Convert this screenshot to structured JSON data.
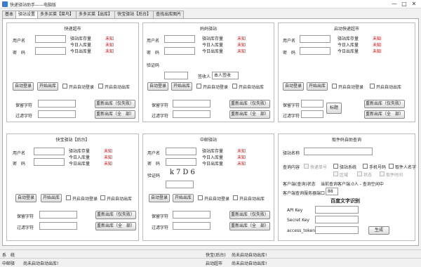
{
  "window": {
    "title": "快递驿站助手——电脑版",
    "min": "—",
    "max": "□",
    "close": "✕"
  },
  "tabs": [
    "基本",
    "驿站设置",
    "多多买菜【菜鸟】",
    "多多买菜【出库】",
    "快宝驿站【后台】",
    "查找出库图片"
  ],
  "common": {
    "user_label": "用户名",
    "pwd_label": "密　码",
    "stock_label": "驿站库存量",
    "today_in_label": "今日入库量",
    "today_out_label": "今日出库量",
    "unknown": "未知",
    "auto_login": "自动登录",
    "start_out": "开始出库",
    "enable_auto_login": "开启自动登录",
    "enable_auto_out": "开启自动出库",
    "keep_label": "保留字符",
    "filter_label": "过滤字符",
    "retry_fail": "重新出库（仅失败）",
    "retry_all": "重新出库（全　部）"
  },
  "p1": {
    "title": "快递超市"
  },
  "p2": {
    "title": "妈妈驿站",
    "captcha_label": "验证码",
    "sign_label": "签收人",
    "sign_value": "本人签收"
  },
  "p3": {
    "title": "启动快递超市",
    "mark_button": "标题"
  },
  "p4": {
    "title": "快宝驿站【后台】"
  },
  "p5": {
    "title": "中邮驿站",
    "captcha_label": "验证码",
    "captcha_text": "k7D6"
  },
  "p6": {
    "title": "取件码自助查询",
    "station_label": "驿站名称",
    "query_label": "查询内容",
    "opts1": [
      "快递单号",
      "驿站系统",
      "手机号码",
      "取件人名字"
    ],
    "opts2": [
      "区域",
      "状态",
      "取件时间"
    ],
    "client_status_label": "客户端(查询)状态",
    "client_status_value": "当前查询客户端:0人 - 查询空闲中",
    "port_label": "客户端查询服务器端口",
    "port_value": "88",
    "ocr_title": "百度文字识别",
    "api_key": "API Key",
    "secret_key": "Secret Key",
    "access_token": "access_token",
    "generate": "生成"
  },
  "status": {
    "row1_left": "系　统",
    "row1_mid": "快宝(后台)",
    "row1_right": "尚未启动自动出库!",
    "row2_left": "中邮驿",
    "row2_left_val": "尚未启动自动出库!",
    "row2_mid": "启动超市",
    "row2_right": "尚未启动自动出库!"
  }
}
